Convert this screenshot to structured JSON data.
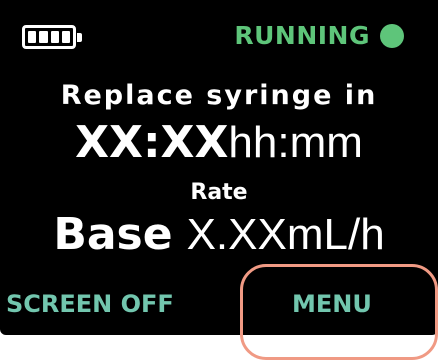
{
  "status_bar": {
    "battery_icon": "battery-full-icon",
    "battery_cells": 4,
    "state_label": "RUNNING",
    "state_indicator_color": "#5ec57a"
  },
  "main": {
    "replace_label": "Replace syringe in",
    "time_value": "XX:XX",
    "time_unit": "hh:mm",
    "rate_label": "Rate",
    "rate_prefix": "Base",
    "rate_value": "X.XX",
    "rate_unit": "mL/h"
  },
  "softkeys": {
    "left_label": "SCREEN OFF",
    "right_label": "MENU",
    "label_color": "#72c6ae"
  },
  "annotation": {
    "highlight_target": "MENU",
    "highlight_color": "#f09a84"
  }
}
